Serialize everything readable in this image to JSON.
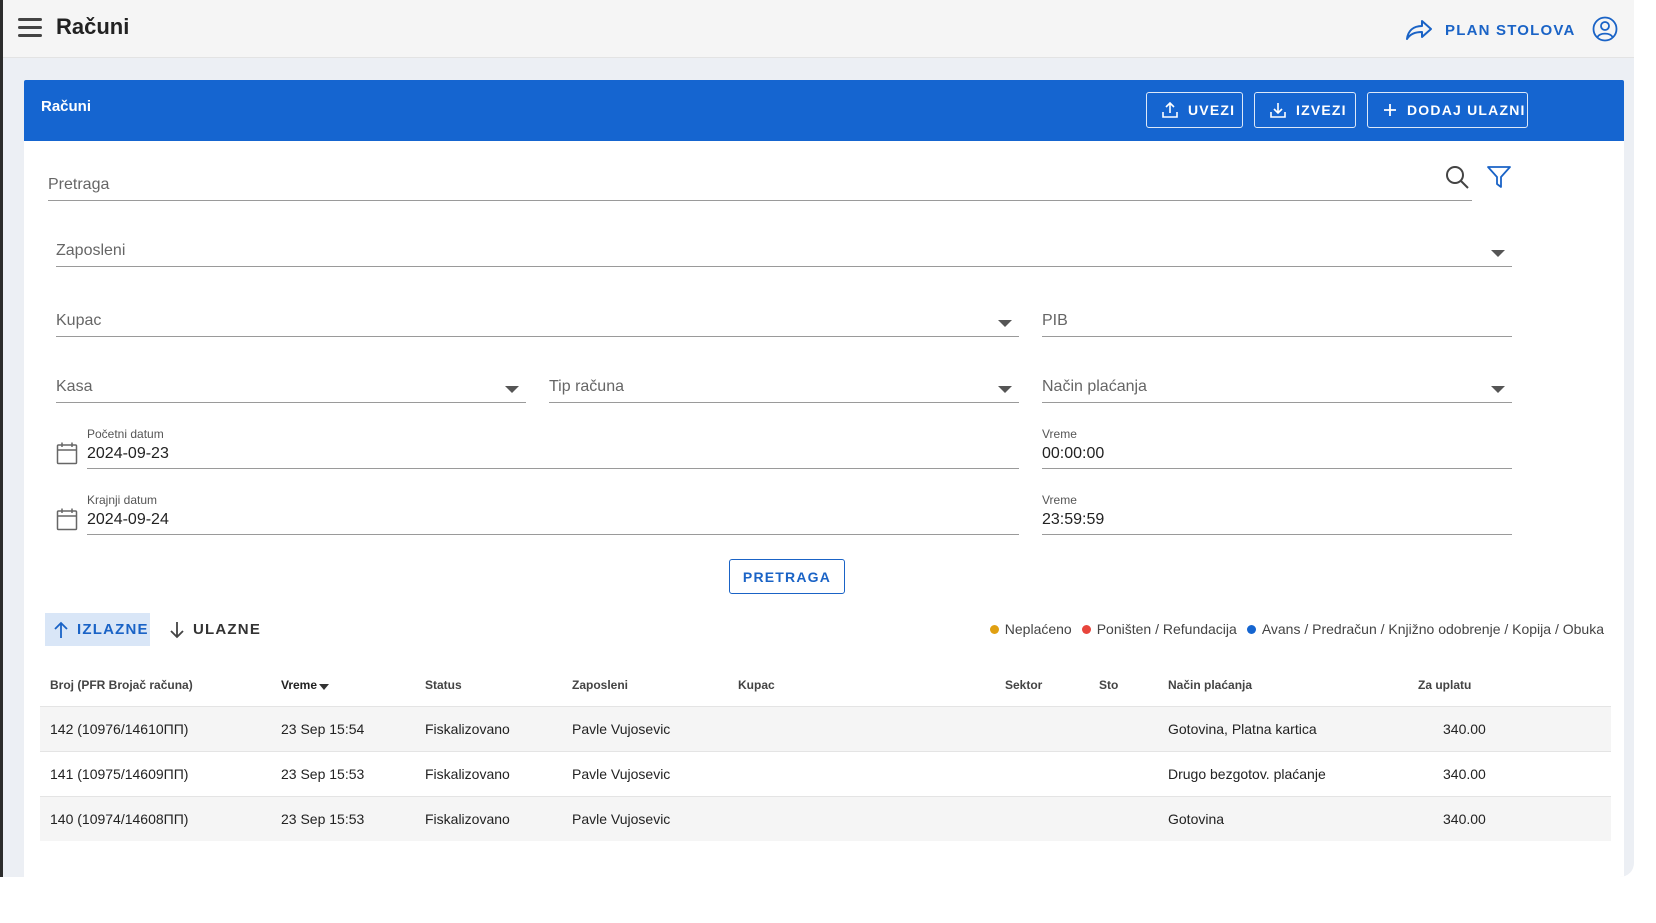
{
  "topbar": {
    "title": "Računi",
    "plan_label": "PLAN STOLOVA"
  },
  "card": {
    "title": "Računi",
    "import_label": "UVEZI",
    "export_label": "IZVEZI",
    "add_label": "DODAJ ULAZNI"
  },
  "filters": {
    "search_placeholder": "Pretraga",
    "employee_label": "Zaposleni",
    "customer_label": "Kupac",
    "pib_label": "PIB",
    "register_label": "Kasa",
    "invoice_type_label": "Tip računa",
    "payment_method_label": "Način plaćanja",
    "start_date_label": "Početni datum",
    "start_date_value": "2024-09-23",
    "start_time_label": "Vreme",
    "start_time_value": "00:00:00",
    "end_date_label": "Krajnji datum",
    "end_date_value": "2024-09-24",
    "end_time_label": "Vreme",
    "end_time_value": "23:59:59",
    "search_button": "PRETRAGA"
  },
  "tabs": {
    "outgoing": "IZLAZNE",
    "incoming": "ULAZNE"
  },
  "legend": [
    {
      "label": "Neplaćeno",
      "color": "#e0a012"
    },
    {
      "label": "Poništen / Refundacija",
      "color": "#e8453c"
    },
    {
      "label": "Avans / Predračun / Knjižno odobrenje / Kopija / Obuka",
      "color": "#1565d0"
    }
  ],
  "table": {
    "headers": {
      "number": "Broj (PFR Brojač računa)",
      "time": "Vreme",
      "status": "Status",
      "employee": "Zaposleni",
      "customer": "Kupac",
      "sector": "Sektor",
      "table": "Sto",
      "payment": "Način plaćanja",
      "amount": "Za uplatu"
    },
    "rows": [
      {
        "number": "142 (10976/14610ПП)",
        "time": "23 Sep 15:54",
        "status": "Fiskalizovano",
        "employee": "Pavle Vujosevic",
        "customer": "",
        "sector": "",
        "table": "",
        "payment": "Gotovina, Platna kartica",
        "amount": "340.00"
      },
      {
        "number": "141 (10975/14609ПП)",
        "time": "23 Sep 15:53",
        "status": "Fiskalizovano",
        "employee": "Pavle Vujosevic",
        "customer": "",
        "sector": "",
        "table": "",
        "payment": "Drugo bezgotov. plaćanje",
        "amount": "340.00"
      },
      {
        "number": "140 (10974/14608ПП)",
        "time": "23 Sep 15:53",
        "status": "Fiskalizovano",
        "employee": "Pavle Vujosevic",
        "customer": "",
        "sector": "",
        "table": "",
        "payment": "Gotovina",
        "amount": "340.00"
      }
    ]
  },
  "colors": {
    "primary": "#1565d0",
    "accent_text": "#1a63c6"
  }
}
